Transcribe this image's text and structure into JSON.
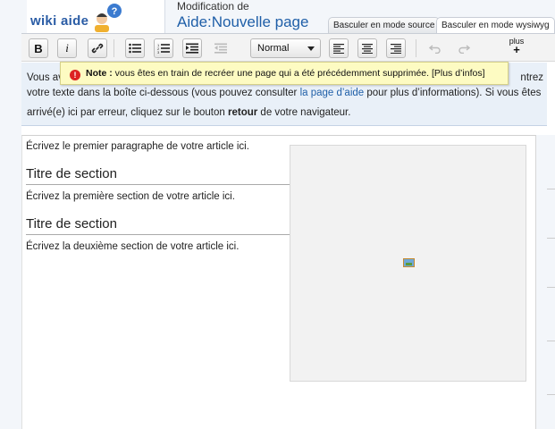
{
  "header": {
    "logo_text": "wiki aide",
    "logo_badge": "?",
    "modif_label": "Modification de",
    "page_title": "Aide:Nouvelle page",
    "tabs": [
      {
        "label": "Basculer en mode source"
      },
      {
        "label": "Basculer en mode wysiwyg"
      }
    ]
  },
  "toolbar": {
    "bold_label": "B",
    "italic_label": "i",
    "format_value": "Normal",
    "plus_label": "plus",
    "plus_sign": "+"
  },
  "notice": {
    "line1_start": "Vous av",
    "line1_end": "ntrez",
    "line2_before_link": "votre texte dans la boîte ci-dessous (vous pouvez consulter ",
    "line2_link": "la page d’aide",
    "line2_after_link": " pour plus d’informations). Si vous êtes",
    "line3_before_bold": "arrivé(e) ici par erreur, cliquez sur le bouton ",
    "line3_bold": "retour",
    "line3_after_bold": " de votre navigateur."
  },
  "tooltip": {
    "icon": "!",
    "bold": "Note :",
    "text": " vous êtes en train de recréer une page qui a été précédemment supprimée. [Plus d’infos]"
  },
  "content": {
    "paragraph1": "Écrivez le premier paragraphe de votre article ici.",
    "section1_title": "Titre de section",
    "section1_text": "Écrivez la première section de votre article ici.",
    "section2_title": "Titre de section",
    "section2_text": "Écrivez la deuxième section de votre article ici."
  },
  "icons": {
    "link": "link-icon",
    "bullet_list": "bullet-list-icon",
    "numbered_list": "numbered-list-icon",
    "indent": "indent-icon",
    "outdent": "outdent-icon",
    "align_left": "align-left-icon",
    "align_center": "align-center-icon",
    "align_right": "align-right-icon",
    "undo": "undo-icon",
    "redo": "redo-icon",
    "image": "image-icon"
  },
  "colors": {
    "link": "#1f5fa8",
    "banner": "#e9f0f8",
    "tooltip": "#fdfbc2",
    "warning": "#dd2222"
  }
}
